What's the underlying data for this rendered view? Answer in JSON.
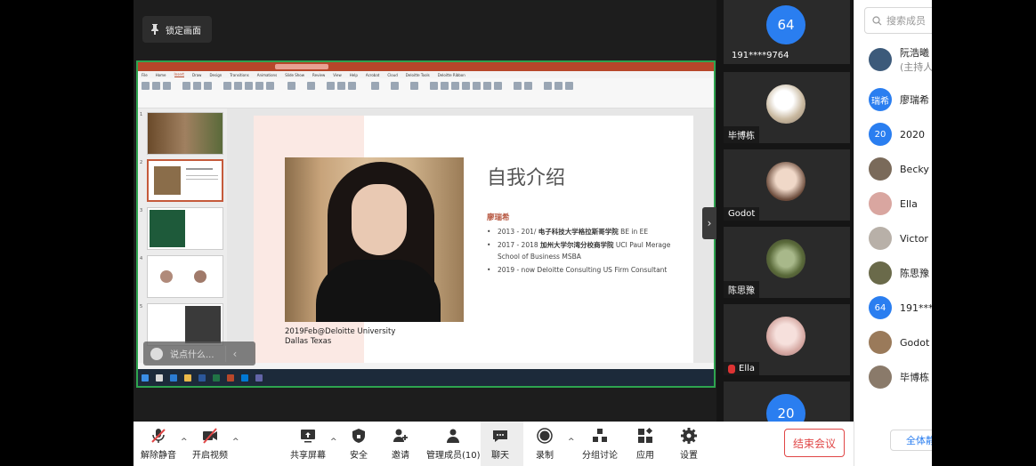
{
  "window": {
    "lock_screen": "锁定画面"
  },
  "ppt": {
    "tabs": [
      "File",
      "Home",
      "Insert",
      "Draw",
      "Design",
      "Transitions",
      "Animations",
      "Slide Show",
      "Review",
      "View",
      "Help",
      "Acrobat",
      "Cloud",
      "Deloitte Tools",
      "Deloitte Ribbon"
    ],
    "active_tab": "Insert",
    "slide": {
      "title": "自我介绍",
      "name": "廖瑞希",
      "bullets": [
        {
          "prefix": "2013 - 201/ ",
          "bold": "电子科技大学格拉斯哥学院",
          "suffix": " BE in EE"
        },
        {
          "prefix": "2017 - 2018 ",
          "bold": "加州大学尔湾分校商学院",
          "suffix": " UCI Paul Merage School of Business MSBA"
        },
        {
          "prefix": "2019 - now ",
          "bold": "",
          "suffix": "Deloitte Consulting US Firm Consultant"
        }
      ],
      "photo_caption_1": "2019Feb@Deloitte University",
      "photo_caption_2": "Dallas Texas"
    },
    "thumb_numbers": [
      "1",
      "2",
      "3",
      "4",
      "5"
    ]
  },
  "chat_input": {
    "placeholder": "说点什么..."
  },
  "videos": [
    {
      "name": "191****9764",
      "avatar_text": "64"
    },
    {
      "name": "毕博栋",
      "avatar_text": ""
    },
    {
      "name": "Godot",
      "avatar_text": ""
    },
    {
      "name": "陈思豫",
      "avatar_text": ""
    },
    {
      "name": "Ella",
      "avatar_text": ""
    },
    {
      "name": "",
      "avatar_text": "20"
    }
  ],
  "participants": {
    "search_placeholder": "搜索成员",
    "members": [
      {
        "name": "阮浩曦",
        "sub": "(主持人",
        "avatar_text": "",
        "color": "#3c5a7a"
      },
      {
        "name": "廖瑞希",
        "sub": "",
        "avatar_text": "瑞希",
        "color": "#2a7ef0"
      },
      {
        "name": "2020",
        "sub": "",
        "avatar_text": "20",
        "color": "#2a7ef0"
      },
      {
        "name": "Becky",
        "sub": "",
        "avatar_text": "",
        "color": "#7a6a5a"
      },
      {
        "name": "Ella",
        "sub": "",
        "avatar_text": "",
        "color": "#d9a6a0"
      },
      {
        "name": "Victor",
        "sub": "",
        "avatar_text": "",
        "color": "#b8b0a8"
      },
      {
        "name": "陈思豫",
        "sub": "",
        "avatar_text": "",
        "color": "#6a6a4a"
      },
      {
        "name": "191****",
        "sub": "",
        "avatar_text": "64",
        "color": "#2a7ef0"
      },
      {
        "name": "Godot",
        "sub": "",
        "avatar_text": "",
        "color": "#9a7a5a"
      },
      {
        "name": "毕博栋",
        "sub": "",
        "avatar_text": "",
        "color": "#8a7a6a"
      }
    ],
    "mute_all": "全体静"
  },
  "toolbar": {
    "unmute": "解除静音",
    "start_video": "开启视频",
    "share_screen": "共享屏幕",
    "security": "安全",
    "invite": "邀请",
    "manage_members": "管理成员(10)",
    "chat": "聊天",
    "record": "录制",
    "breakout": "分组讨论",
    "apps": "应用",
    "settings": "设置",
    "end_meeting": "结束会议"
  },
  "colors": {
    "accent_blue": "#2a7ef0",
    "end_red": "#e04646",
    "ppt_brand": "#b7472a",
    "share_border": "#2ea44f"
  }
}
